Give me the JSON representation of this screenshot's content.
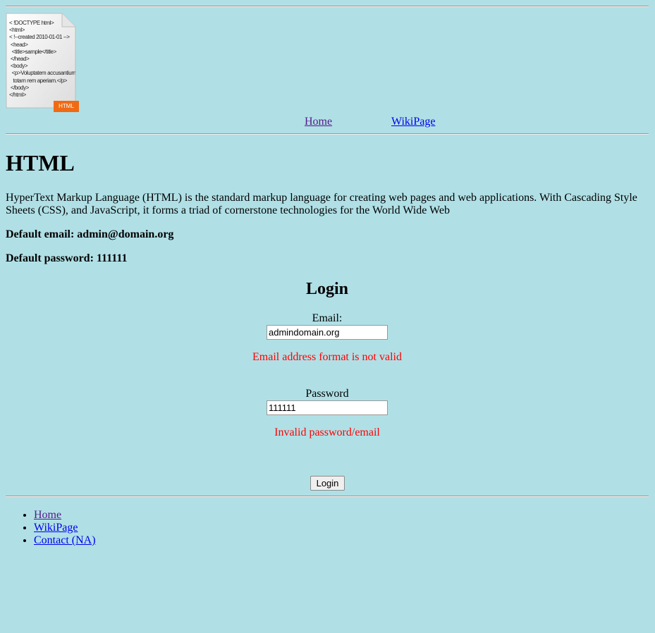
{
  "logo": {
    "code_lines": [
      "< !DOCTYPE html>",
      "<html>",
      "< !--created 2010-01-01 -->",
      " <head>",
      "  <title>sample</title>",
      " </head>",
      " <body>",
      "  <p>Voluptatem accusantium",
      "   totam rem aperiam.</p>",
      " </body>",
      "</html>"
    ],
    "badge": "HTML",
    "badge_color": "#f06a14"
  },
  "top_nav": {
    "home": "Home",
    "wiki": "WikiPage"
  },
  "page": {
    "title": "HTML",
    "description": "HyperText Markup Language (HTML) is the standard markup language for creating web pages and web applications. With Cascading Style Sheets (CSS), and JavaScript, it forms a triad of cornerstone technologies for the World Wide Web",
    "default_email": "Default email: admin@domain.org",
    "default_password": "Default password: 111111"
  },
  "login": {
    "title": "Login",
    "email_label": "Email:",
    "email_value": "admindomain.org",
    "email_error": "Email address format is not valid",
    "password_label": "Password",
    "password_value": "111111",
    "password_error": "Invalid password/email",
    "submit_label": "Login"
  },
  "footer_nav": {
    "home": "Home",
    "wiki": "WikiPage",
    "contact": "Contact (NA)"
  },
  "colors": {
    "background": "#b0e0e6",
    "error": "#ff0000",
    "link": "#0000ee",
    "visited_link": "#551a8b"
  }
}
